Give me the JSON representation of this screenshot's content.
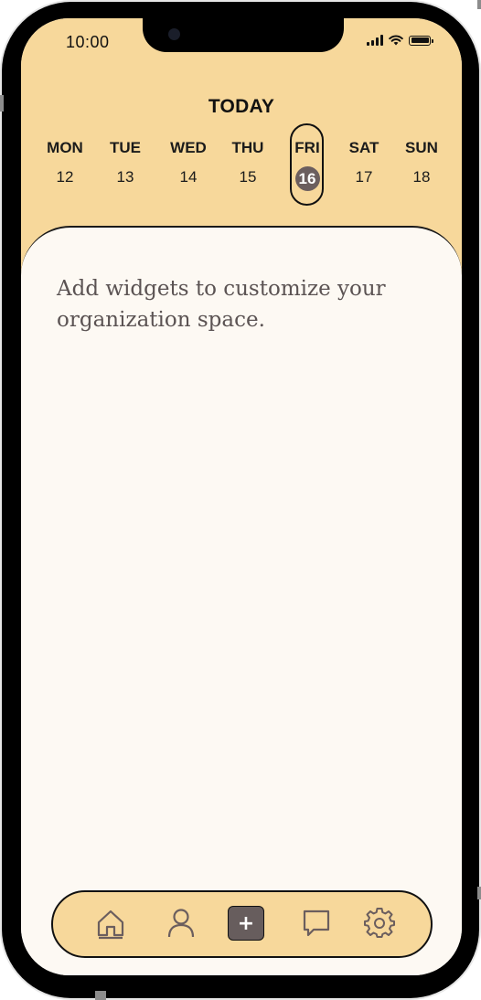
{
  "status_bar": {
    "time": "10:00"
  },
  "header": {
    "title": "TODAY",
    "days": [
      {
        "name": "MON",
        "num": "12"
      },
      {
        "name": "TUE",
        "num": "13"
      },
      {
        "name": "WED",
        "num": "14"
      },
      {
        "name": "THU",
        "num": "15"
      },
      {
        "name": "FRI",
        "num": "16"
      },
      {
        "name": "SAT",
        "num": "17"
      },
      {
        "name": "SUN",
        "num": "18"
      }
    ],
    "selected_day": "FRI"
  },
  "content": {
    "hint": "Add widgets to customize your organization space."
  },
  "nav": {
    "add_label": "+",
    "items": [
      "home-icon",
      "profile-icon",
      "add-button",
      "chat-icon",
      "settings-icon"
    ]
  },
  "colors": {
    "header_bg": "#f7d89b",
    "content_bg": "#fdf9f3",
    "accent_dark": "#675d5d",
    "hint_text": "#5b5353"
  }
}
